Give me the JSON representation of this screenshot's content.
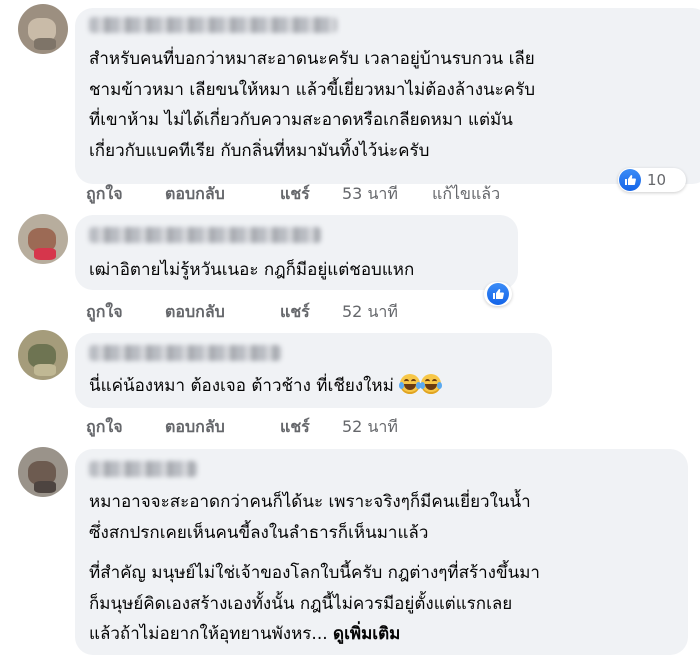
{
  "comments": [
    {
      "text_lines": [
        "สำหรับคนที่บอกว่าหมาสะอาดนะครับ เวลาอยู่บ้านรบกวน เลีย",
        "ชามข้าวหมา เลียขนให้หมา แล้วขี้เยี่ยวหมาไม่ต้องล้างนะครับ",
        "ที่เขาห้าม ไม่ได้เกี่ยวกับความสะอาดหรือเกลียดหมา แต่มัน",
        "เกี่ยวกับแบคทีเรีย กับกลิ่นที่หมามันทิ้งไว้น่ะครับ"
      ],
      "actions": {
        "like": "ถูกใจ",
        "reply": "ตอบกลับ",
        "share": "แชร์",
        "time": "53 นาที",
        "edited": "แก้ไขแล้ว"
      },
      "reaction": {
        "icon": "like-icon",
        "count": "10"
      }
    },
    {
      "text_lines": [
        "เฒ่าอิตายไม่รู้หวันเนอะ กฎก็มีอยู่แต่ชอบแหก"
      ],
      "actions": {
        "like": "ถูกใจ",
        "reply": "ตอบกลับ",
        "share": "แชร์",
        "time": "52 นาที"
      },
      "reaction": {
        "icon": "like-icon"
      }
    },
    {
      "text_lines": [
        "นี่แค่น้องหมา ต้องเจอ ต้าวช้าง ที่เชียงใหม่"
      ],
      "emoji": [
        "laughing-tears-emoji",
        "laughing-tears-emoji"
      ],
      "actions": {
        "like": "ถูกใจ",
        "reply": "ตอบกลับ",
        "share": "แชร์",
        "time": "52 นาที"
      }
    },
    {
      "paragraph1": [
        "หมาอาจจะสะอาดกว่าคนก็ได้นะ เพราะจริงๆก็มีคนเยี่ยวในน้ำ",
        "ซึ่งสกปรกเคยเห็นคนขี้ลงในลำธารก็เห็นมาแล้ว"
      ],
      "paragraph2": [
        "ที่สำคัญ มนุษย์ไม่ใช่เจ้าของโลกใบนี้ครับ กฎต่างๆที่สร้างขึ้นมา",
        "ก็มนุษย์คิดเองสร้างเองทั้งนั้น กฎนี้ไม่ควรมีอยู่ตั้งแต่แรกเลย"
      ],
      "last_line": "แล้วถ้าไม่อยากให้อุทยานพังหร...",
      "see_more": "ดูเพิ่มเติม"
    }
  ],
  "colors": {
    "bubble": "#f0f2f5",
    "text": "#050505",
    "secondary": "#65676b",
    "like_blue": "#1877f2"
  }
}
